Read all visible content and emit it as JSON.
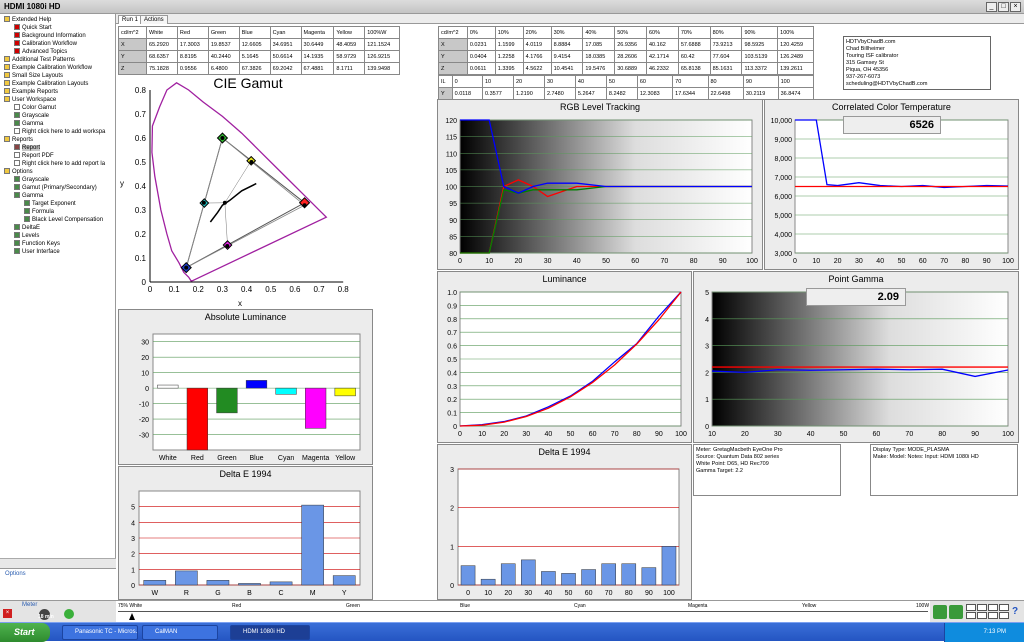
{
  "window": {
    "title": "HDMI 1080i HD"
  },
  "tree": {
    "items": [
      {
        "label": "Extended Help",
        "depth": 0,
        "color": "#f0c840"
      },
      {
        "label": "Quick Start",
        "depth": 1,
        "color": "#d00000"
      },
      {
        "label": "Background Information",
        "depth": 1,
        "color": "#d00000"
      },
      {
        "label": "Calibration Workflow",
        "depth": 1,
        "color": "#d00000"
      },
      {
        "label": "Advanced Topics",
        "depth": 1,
        "color": "#d00000"
      },
      {
        "label": "Additional Test Patterns",
        "depth": 0,
        "color": "#f0c840"
      },
      {
        "label": "Example Calibration Workflow",
        "depth": 0,
        "color": "#f0c840"
      },
      {
        "label": "Small Size Layouts",
        "depth": 0,
        "color": "#f0c840"
      },
      {
        "label": "Example Calibration Layouts",
        "depth": 0,
        "color": "#f0c840"
      },
      {
        "label": "Example Reports",
        "depth": 0,
        "color": "#f0c840"
      },
      {
        "label": "User Workspace",
        "depth": 0,
        "color": "#f0c840"
      },
      {
        "label": "Color Gamut",
        "depth": 1,
        "color": "#ffffff"
      },
      {
        "label": "Grayscale",
        "depth": 1,
        "color": "#4a8a4a"
      },
      {
        "label": "Gamma",
        "depth": 1,
        "color": "#4a8a4a"
      },
      {
        "label": "Right click here to add workspa",
        "depth": 1,
        "color": "#ffffff"
      },
      {
        "label": "Reports",
        "depth": 0,
        "color": "#f0c840"
      },
      {
        "label": "Report",
        "depth": 1,
        "color": "#884444",
        "selected": true
      },
      {
        "label": "Report PDF",
        "depth": 1,
        "color": "#ffffff"
      },
      {
        "label": "Right click here to add report la",
        "depth": 1,
        "color": "#ffffff"
      },
      {
        "label": "Options",
        "depth": 0,
        "color": "#f0c840"
      },
      {
        "label": "Grayscale",
        "depth": 1,
        "color": "#4a8a4a"
      },
      {
        "label": "Gamut (Primary/Secondary)",
        "depth": 1,
        "color": "#4a8a4a"
      },
      {
        "label": "Gamma",
        "depth": 1,
        "color": "#4a8a4a"
      },
      {
        "label": "Target Exponent",
        "depth": 2,
        "color": "#4a8a4a"
      },
      {
        "label": "Formula",
        "depth": 2,
        "color": "#4a8a4a"
      },
      {
        "label": "Black Level Compensation",
        "depth": 2,
        "color": "#4a8a4a"
      },
      {
        "label": "DeltaE",
        "depth": 1,
        "color": "#4a8a4a"
      },
      {
        "label": "Levels",
        "depth": 1,
        "color": "#4a8a4a"
      },
      {
        "label": "Function Keys",
        "depth": 1,
        "color": "#4a8a4a"
      },
      {
        "label": "User Interface",
        "depth": 1,
        "color": "#4a8a4a"
      }
    ],
    "options_link": "Options",
    "meter_label": "Meter",
    "meter_value": "18 min"
  },
  "tabs": [
    "Run 1",
    "Actions"
  ],
  "primary_table": {
    "headers": [
      "cd/m^2",
      "White",
      "Red",
      "Green",
      "Blue",
      "Cyan",
      "Magenta",
      "Yellow",
      "100%W"
    ],
    "rows": [
      [
        "X",
        "65.2920",
        "17.3003",
        "19.8537",
        "12.6605",
        "34.6951",
        "30.6449",
        "48.4059",
        "121.1524"
      ],
      [
        "Y",
        "68.6357",
        "8.8195",
        "40.2440",
        "5.1645",
        "50.6614",
        "14.1935",
        "58.9729",
        "126.9215"
      ],
      [
        "Z",
        "75.1828",
        "0.9556",
        "6.4800",
        "67.3826",
        "69.2042",
        "67.4881",
        "8.1711",
        "139.9498"
      ]
    ]
  },
  "gray_table": {
    "headers": [
      "cd/m^2",
      "0%",
      "10%",
      "20%",
      "30%",
      "40%",
      "50%",
      "60%",
      "70%",
      "80%",
      "90%",
      "100%"
    ],
    "rows": [
      [
        "X",
        "0.0231",
        "1.1599",
        "4.0119",
        "8.8884",
        "17.085",
        "26.9356",
        "40.162",
        "57.6888",
        "73.9213",
        "98.5925",
        "120.4259"
      ],
      [
        "Y",
        "0.0404",
        "1.2258",
        "4.1766",
        "9.4154",
        "18.0385",
        "28.2606",
        "42.1714",
        "60.42",
        "77.604",
        "103.5139",
        "126.2489"
      ],
      [
        "Z",
        "0.0611",
        "1.3395",
        "4.5622",
        "10.4541",
        "19.5476",
        "30.6889",
        "46.2332",
        "65.8138",
        "85.1631",
        "113.3372",
        "139.2611"
      ]
    ]
  },
  "ire_table": {
    "headers": [
      "IL",
      "0",
      "10",
      "20",
      "30",
      "40",
      "50",
      "60",
      "70",
      "80",
      "90",
      "100"
    ],
    "rows": [
      [
        "Y",
        "0.0118",
        "0.3577",
        "1.2190",
        "2.7480",
        "5.2647",
        "8.2482",
        "12.3083",
        "17.6344",
        "22.6498",
        "30.2119",
        "36.8474"
      ]
    ]
  },
  "contact": {
    "lines": [
      "HDTVbyChadB.com",
      "Chad Billheimer",
      "Touring ISF calibrator",
      "315 Gamsey St",
      "Piqua, OH 45356",
      "937-267-6073",
      "scheduling@HDTVbyChadB.com"
    ]
  },
  "meter_info": {
    "lines": [
      "Meter: GretagMacbeth EyeOne Pro",
      "Source: Quantum Data 802 series",
      "White Point: D65, HD Rec709",
      "Gamma Target: 2.2"
    ]
  },
  "display_info": {
    "lines": [
      "Display Type: MODE_PLASMA",
      "Make: Model: Notes: Input: HDMI 1080i HD"
    ]
  },
  "pattern_bar": {
    "labels": [
      "75% White",
      "Red",
      "Green",
      "Blue",
      "Cyan",
      "Magenta",
      "Yellow",
      "100W"
    ]
  },
  "taskbar": {
    "start": "Start",
    "buttons": [
      "Panasonic TC - Micros...",
      "CalMAN",
      "HDMI 1080i HD"
    ],
    "clock": "7:13 PM"
  },
  "chart_data": [
    {
      "type": "scatter",
      "title": "CIE Gamut",
      "xlabel": "x",
      "ylabel": "y",
      "xlim": [
        0,
        0.8
      ],
      "ylim": [
        0,
        0.8
      ],
      "target_primaries": [
        [
          0.64,
          0.33
        ],
        [
          0.3,
          0.6
        ],
        [
          0.15,
          0.06
        ]
      ],
      "measured_primaries": [
        [
          0.64,
          0.32
        ],
        [
          0.3,
          0.6
        ],
        [
          0.15,
          0.06
        ]
      ],
      "secondaries_target": [
        [
          0.225,
          0.329
        ],
        [
          0.321,
          0.154
        ],
        [
          0.419,
          0.505
        ]
      ],
      "secondaries_measured": [
        [
          0.223,
          0.33
        ],
        [
          0.32,
          0.15
        ],
        [
          0.42,
          0.5
        ]
      ],
      "white": [
        0.31,
        0.33
      ],
      "blackbody": [
        [
          0.44,
          0.41
        ],
        [
          0.38,
          0.38
        ],
        [
          0.33,
          0.34
        ],
        [
          0.3,
          0.32
        ],
        [
          0.28,
          0.29
        ],
        [
          0.25,
          0.25
        ]
      ]
    },
    {
      "type": "bar",
      "title": "Absolute Luminance",
      "categories": [
        "White",
        "Red",
        "Green",
        "Blue",
        "Cyan",
        "Magenta",
        "Yellow"
      ],
      "values": [
        2,
        -40,
        -16,
        5,
        -4,
        -26,
        -5
      ],
      "colors": [
        "#ffffff",
        "#ff0000",
        "#228b22",
        "#0000ff",
        "#00ffff",
        "#ff00ff",
        "#ffff00"
      ],
      "ylim": [
        -40,
        35
      ]
    },
    {
      "type": "bar",
      "title": "Delta E 1994",
      "categories": [
        "W",
        "R",
        "G",
        "B",
        "C",
        "M",
        "Y"
      ],
      "values": [
        0.3,
        0.9,
        0.3,
        0.1,
        0.2,
        5.1,
        0.6
      ],
      "ylim": [
        0,
        6
      ]
    },
    {
      "type": "line",
      "title": "RGB Level Tracking",
      "x": [
        0,
        10,
        15,
        20,
        25,
        30,
        40,
        50,
        60,
        70,
        80,
        90,
        100
      ],
      "series": [
        {
          "color": "#ff0000",
          "values": [
            80,
            80,
            100,
            102,
            100,
            97,
            100,
            100,
            100,
            100,
            100,
            100,
            100
          ]
        },
        {
          "color": "#008000",
          "values": [
            80,
            80,
            99,
            98,
            99,
            99,
            99,
            100,
            100,
            100,
            100,
            100,
            100
          ]
        },
        {
          "color": "#0000ff",
          "values": [
            120,
            120,
            100,
            98,
            100,
            101,
            101,
            100,
            100,
            100,
            100,
            100,
            100
          ]
        }
      ],
      "ylim": [
        80,
        120
      ],
      "xlim": [
        0,
        100
      ]
    },
    {
      "type": "line",
      "title": "Correlated Color Temperature",
      "x": [
        0,
        10,
        15,
        20,
        30,
        40,
        50,
        60,
        70,
        80,
        90,
        100
      ],
      "series": [
        {
          "color": "#0000ff",
          "values": [
            10000,
            10000,
            6600,
            6550,
            6700,
            6550,
            6500,
            6550,
            6450,
            6500,
            6550,
            6526
          ]
        },
        {
          "color": "#ff0000",
          "values": [
            6500,
            6500,
            6500,
            6500,
            6500,
            6500,
            6500,
            6500,
            6500,
            6500,
            6500,
            6500
          ]
        }
      ],
      "ylim": [
        3000,
        10000
      ],
      "xlim": [
        0,
        100
      ],
      "readout": "6526"
    },
    {
      "type": "line",
      "title": "Luminance",
      "x": [
        0,
        10,
        20,
        30,
        40,
        50,
        60,
        70,
        80,
        90,
        100
      ],
      "series": [
        {
          "color": "#0000ff",
          "values": [
            0,
            0.01,
            0.033,
            0.075,
            0.143,
            0.224,
            0.334,
            0.479,
            0.615,
            0.82,
            1.0
          ]
        },
        {
          "color": "#ff0000",
          "values": [
            0,
            0.006,
            0.029,
            0.071,
            0.133,
            0.218,
            0.325,
            0.456,
            0.612,
            0.793,
            1.0
          ]
        }
      ],
      "ylim": [
        0,
        1
      ],
      "xlim": [
        0,
        100
      ]
    },
    {
      "type": "line",
      "title": "Point Gamma",
      "x": [
        10,
        20,
        30,
        40,
        50,
        60,
        70,
        80,
        90,
        100
      ],
      "series": [
        {
          "color": "#0000ff",
          "values": [
            2.05,
            2.0,
            2.1,
            2.08,
            2.1,
            2.12,
            2.1,
            2.12,
            1.85,
            2.09
          ]
        },
        {
          "color": "#ff0000",
          "values": [
            2.2,
            2.2,
            2.2,
            2.2,
            2.2,
            2.2,
            2.2,
            2.2,
            2.2,
            2.2
          ]
        }
      ],
      "ylim": [
        0,
        5
      ],
      "xlim": [
        10,
        100
      ],
      "readout": "2.09"
    },
    {
      "type": "bar",
      "title": "Delta E 1994",
      "categories": [
        "0",
        "10",
        "20",
        "30",
        "40",
        "50",
        "60",
        "70",
        "80",
        "90",
        "100"
      ],
      "values": [
        0.5,
        0.15,
        0.55,
        0.65,
        0.35,
        0.3,
        0.4,
        0.55,
        0.55,
        0.45,
        1.0
      ],
      "ylim": [
        0,
        3
      ]
    }
  ]
}
